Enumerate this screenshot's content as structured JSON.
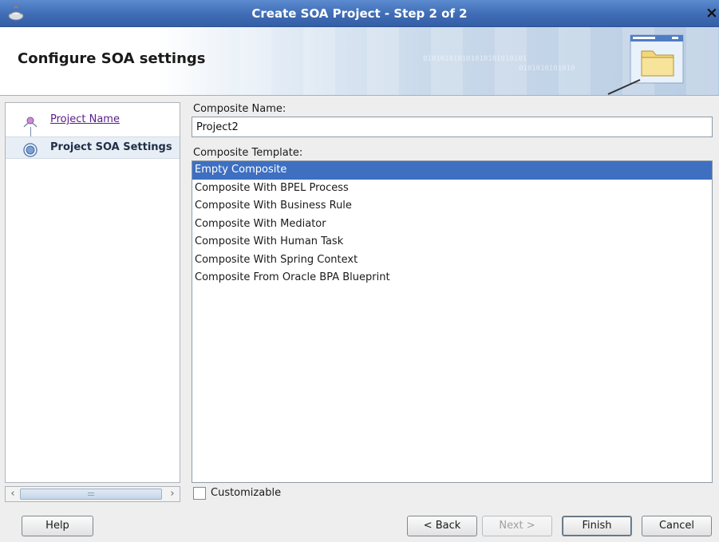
{
  "window": {
    "title": "Create SOA Project - Step 2 of 2",
    "close_glyph": "×"
  },
  "header": {
    "heading": "Configure SOA settings",
    "binary_text": "010101010101010101010101",
    "binary_text_2": "0101010101010"
  },
  "nav": {
    "steps": [
      {
        "label": "Project Name",
        "state": "visited"
      },
      {
        "label": "Project SOA Settings",
        "state": "current"
      }
    ],
    "scroll_left": "‹",
    "scroll_right": "›"
  },
  "form": {
    "composite_name_label": "Composite Name:",
    "composite_name_value": "Project2",
    "composite_template_label": "Composite Template:",
    "templates": [
      "Empty Composite",
      "Composite With BPEL Process",
      "Composite With Business Rule",
      "Composite With Mediator",
      "Composite With Human Task",
      "Composite With Spring Context",
      "Composite From Oracle BPA Blueprint"
    ],
    "selected_template": "Empty Composite",
    "customizable_label": "Customizable",
    "customizable_checked": false
  },
  "buttons": {
    "help": "Help",
    "back": "< Back",
    "next": "Next >",
    "finish": "Finish",
    "cancel": "Cancel"
  },
  "colors": {
    "titlebar": "#3f6cb5",
    "selection": "#3e6fc1",
    "visited_link": "#5b1b8c"
  }
}
